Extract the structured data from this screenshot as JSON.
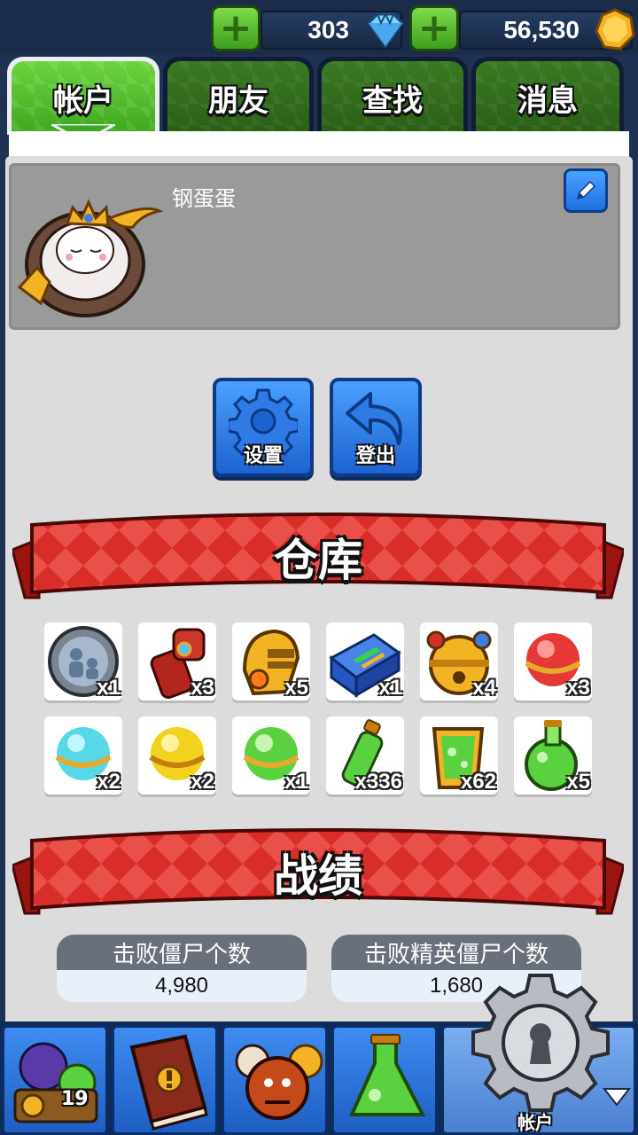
{
  "currency": {
    "gems": "303",
    "coins": "56,530",
    "add_symbol": "+"
  },
  "tabs": [
    {
      "label": "帐户",
      "active": true
    },
    {
      "label": "朋友",
      "active": false
    },
    {
      "label": "查找",
      "active": false
    },
    {
      "label": "消息",
      "active": false
    }
  ],
  "profile": {
    "username": "钢蛋蛋",
    "avatar_icon": "crowned-egg-avatar-icon",
    "edit_icon": "pencil-icon"
  },
  "actions": {
    "settings_label": "设置",
    "logout_label": "登出"
  },
  "warehouse": {
    "title": "仓库",
    "items": [
      {
        "icon": "stone-relief-coin-icon",
        "count": "x1"
      },
      {
        "icon": "red-glove-icon",
        "count": "x3"
      },
      {
        "icon": "gold-helmet-icon",
        "count": "x5"
      },
      {
        "icon": "blue-battery-icon",
        "count": "x1"
      },
      {
        "icon": "golden-bell-icon",
        "count": "x4"
      },
      {
        "icon": "red-orb-icon",
        "count": "x3"
      },
      {
        "icon": "cyan-orb-icon",
        "count": "x2"
      },
      {
        "icon": "yellow-orb-icon",
        "count": "x2"
      },
      {
        "icon": "green-orb-icon",
        "count": "x1"
      },
      {
        "icon": "green-vial-icon",
        "count": "x336"
      },
      {
        "icon": "green-ooze-frame-icon",
        "count": "x62"
      },
      {
        "icon": "green-potion-flask-icon",
        "count": "x5"
      }
    ]
  },
  "record": {
    "title": "战绩",
    "stats": [
      {
        "label": "击败僵尸个数",
        "value": "4,980"
      },
      {
        "label": "击败精英僵尸个数",
        "value": "1,680"
      }
    ]
  },
  "nav": {
    "shop_badge": "19",
    "active_label": "帐户"
  },
  "colors": {
    "tab_green": "#3da71e",
    "button_blue": "#1d63cf",
    "ribbon_red": "#d92d2a"
  }
}
